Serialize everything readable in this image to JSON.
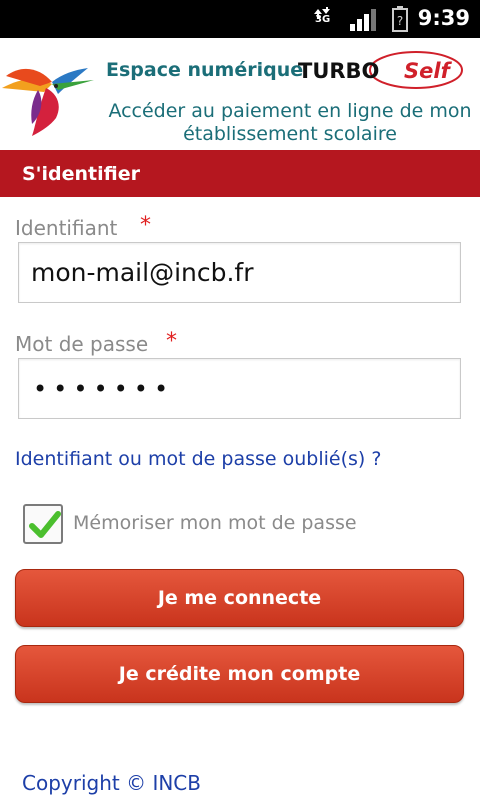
{
  "status_bar": {
    "network": "3G",
    "time": "9:39"
  },
  "header": {
    "app_title": "Espace numérique",
    "brand_turbo": "TURBO",
    "brand_self": "Self",
    "subtitle": "Accéder au paiement en ligne de mon établissement scolaire"
  },
  "section": {
    "title": "S'identifier"
  },
  "form": {
    "identifier_label": "Identifiant",
    "identifier_value": "mon-mail@incb.fr",
    "password_label": "Mot de passe",
    "password_mask": "•••••••",
    "required_mark": "*",
    "forgot_link": "Identifiant ou mot de passe oublié(s) ?",
    "remember_label": "Mémoriser mon mot de passe",
    "remember_checked": true
  },
  "buttons": {
    "connect": "Je me connecte",
    "credit": "Je crédite mon compte"
  },
  "footer": {
    "copyright": "Copyright © INCB"
  },
  "colors": {
    "accent_red": "#b5171f",
    "button_orange": "#d8462b",
    "title_teal": "#1b6e78",
    "link_blue": "#1d3fa8"
  }
}
